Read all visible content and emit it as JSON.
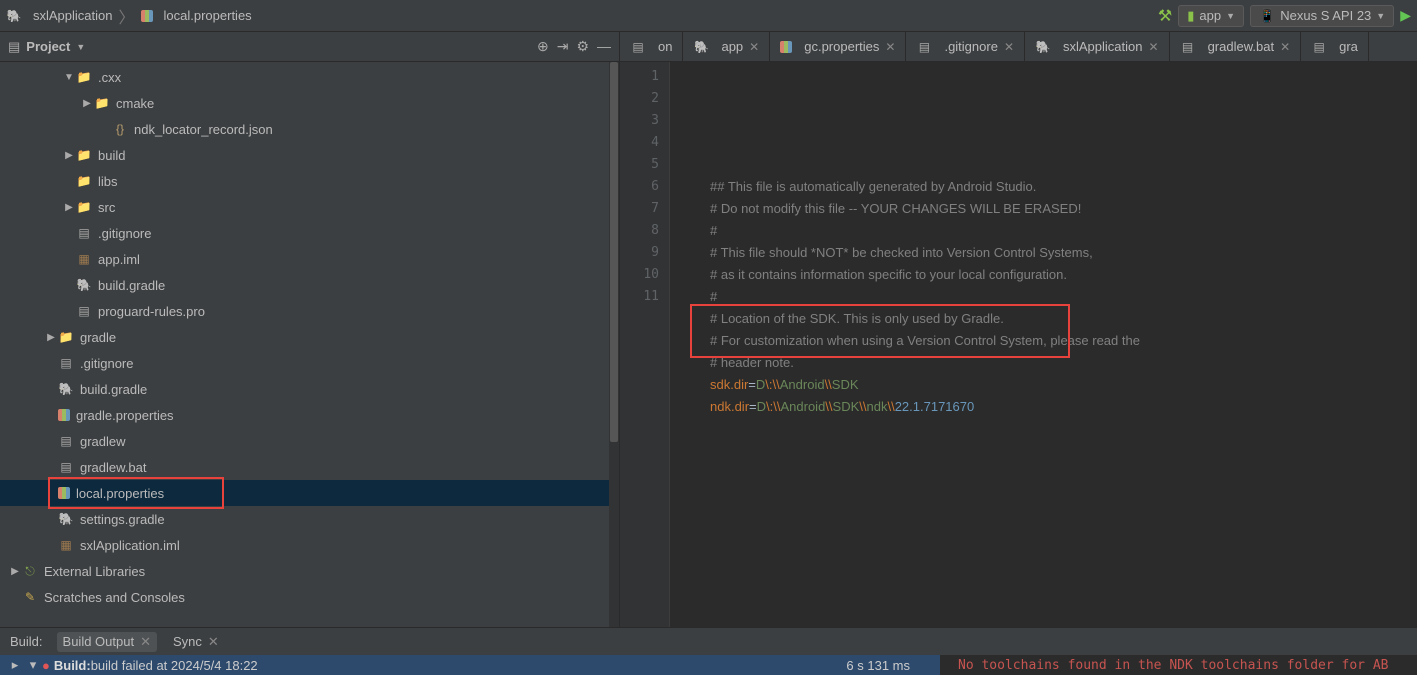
{
  "breadcrumb": {
    "items": [
      "sxlApplication",
      "local.properties"
    ]
  },
  "toolbar": {
    "runConfig": "app",
    "device": "Nexus S API 23"
  },
  "project": {
    "title": "Project",
    "tree": [
      {
        "depth": 3,
        "exp": "down",
        "iconCls": "folder orange",
        "label": ".cxx"
      },
      {
        "depth": 4,
        "exp": "right",
        "iconCls": "folder orange",
        "label": "cmake"
      },
      {
        "depth": 5,
        "exp": "none",
        "iconCls": "json",
        "label": "ndk_locator_record.json"
      },
      {
        "depth": 3,
        "exp": "right",
        "iconCls": "folder orange",
        "label": "build"
      },
      {
        "depth": 3,
        "exp": "none",
        "iconCls": "folder",
        "label": "libs"
      },
      {
        "depth": 3,
        "exp": "right",
        "iconCls": "folder",
        "label": "src"
      },
      {
        "depth": 3,
        "exp": "none",
        "iconCls": "file",
        "label": ".gitignore"
      },
      {
        "depth": 3,
        "exp": "none",
        "iconCls": "iml",
        "label": "app.iml"
      },
      {
        "depth": 3,
        "exp": "none",
        "iconCls": "gradle",
        "label": "build.gradle"
      },
      {
        "depth": 3,
        "exp": "none",
        "iconCls": "file",
        "label": "proguard-rules.pro"
      },
      {
        "depth": 2,
        "exp": "right",
        "iconCls": "folder",
        "label": "gradle"
      },
      {
        "depth": 2,
        "exp": "none",
        "iconCls": "file",
        "label": ".gitignore"
      },
      {
        "depth": 2,
        "exp": "none",
        "iconCls": "gradle",
        "label": "build.gradle"
      },
      {
        "depth": 2,
        "exp": "none",
        "iconCls": "props",
        "label": "gradle.properties"
      },
      {
        "depth": 2,
        "exp": "none",
        "iconCls": "file",
        "label": "gradlew"
      },
      {
        "depth": 2,
        "exp": "none",
        "iconCls": "file",
        "label": "gradlew.bat"
      },
      {
        "depth": 2,
        "exp": "none",
        "iconCls": "props",
        "label": "local.properties",
        "selected": true
      },
      {
        "depth": 2,
        "exp": "none",
        "iconCls": "gradle",
        "label": "settings.gradle"
      },
      {
        "depth": 2,
        "exp": "none",
        "iconCls": "iml",
        "label": "sxlApplication.iml"
      },
      {
        "depth": 0,
        "exp": "right",
        "iconCls": "lib",
        "label": "External Libraries"
      },
      {
        "depth": 0,
        "exp": "none",
        "iconCls": "scratch",
        "label": "Scratches and Consoles"
      }
    ]
  },
  "tabs": [
    {
      "icon": "file",
      "label": "on",
      "close": false,
      "cut": true
    },
    {
      "icon": "gradle",
      "label": "app",
      "close": true
    },
    {
      "icon": "props",
      "label": "gc.properties",
      "close": true
    },
    {
      "icon": "file",
      "label": ".gitignore",
      "close": true
    },
    {
      "icon": "gradle",
      "label": "sxlApplication",
      "close": true
    },
    {
      "icon": "file",
      "label": "gradlew.bat",
      "close": true
    },
    {
      "icon": "file",
      "label": "gra",
      "close": false,
      "cut": true
    }
  ],
  "editor": {
    "lines": [
      "## This file is automatically generated by Android Studio.",
      "# Do not modify this file -- YOUR CHANGES WILL BE ERASED!",
      "#",
      "# This file should *NOT* be checked into Version Control Systems,",
      "# as it contains information specific to your local configuration.",
      "#",
      "# Location of the SDK. This is only used by Gradle.",
      "# For customization when using a Version Control System, please read the",
      "# header note."
    ],
    "sdkLine": {
      "key": "sdk.dir",
      "eq": "=",
      "d": "D",
      "colon": "\\:",
      "sep": "\\\\",
      "android": "Android",
      "sdk": "SDK"
    },
    "ndkLine": {
      "key": "ndk.dir",
      "eq": "=",
      "d": "D",
      "colon": "\\:",
      "sep": "\\\\",
      "android": "Android",
      "sdk": "SDK",
      "ndk": "ndk",
      "ver": "22.1.7171670"
    }
  },
  "build": {
    "label": "Build:",
    "tabs": [
      {
        "label": "Build Output",
        "sel": true
      },
      {
        "label": "Sync",
        "sel": false
      }
    ],
    "statusBold": "Build:",
    "statusText": " build failed at 2024/5/4 18:22",
    "elapsed": "6 s 131 ms",
    "ndkError": "No toolchains found in the NDK toolchains folder for AB"
  }
}
